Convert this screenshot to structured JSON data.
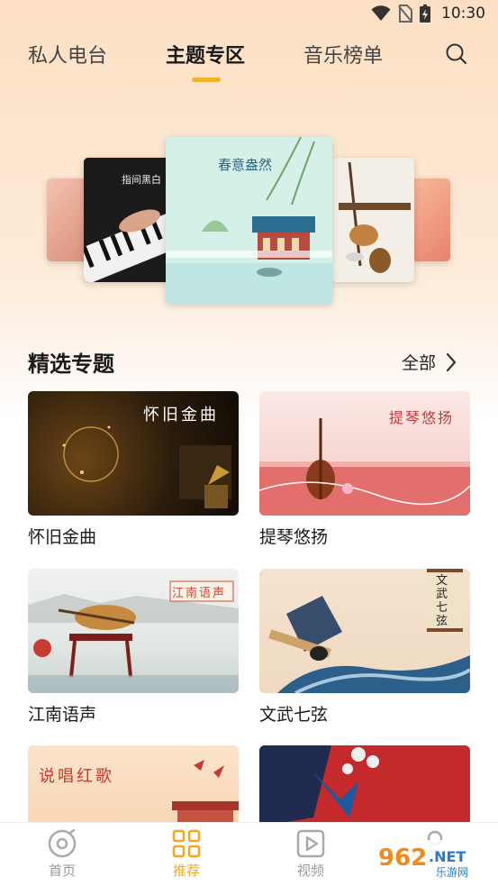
{
  "status_bar": {
    "time": "10:30"
  },
  "top_tabs": [
    {
      "label": "私人电台",
      "active": false
    },
    {
      "label": "主题专区",
      "active": true
    },
    {
      "label": "音乐榜单",
      "active": false
    }
  ],
  "carousel": {
    "center_title": "春意盎然",
    "left_title": "指间黑白"
  },
  "section": {
    "title": "精选专题",
    "all_label": "全部"
  },
  "topics": [
    {
      "caption": "怀旧金曲",
      "overlay": "怀旧金曲"
    },
    {
      "caption": "提琴悠扬",
      "overlay": "提琴悠扬"
    },
    {
      "caption": "江南语声",
      "overlay": "江南语声"
    },
    {
      "caption": "文武七弦",
      "overlay": "文武七弦"
    },
    {
      "caption": "",
      "overlay": "说唱红歌"
    },
    {
      "caption": "",
      "overlay": ""
    }
  ],
  "bottom_nav": [
    {
      "label": "首页",
      "icon": "disc-icon",
      "active": false
    },
    {
      "label": "推荐",
      "icon": "grid-icon",
      "active": true
    },
    {
      "label": "视频",
      "icon": "video-play-icon",
      "active": false
    },
    {
      "label": "",
      "icon": "profile-icon",
      "active": false
    }
  ],
  "watermark": {
    "number": "962",
    "suffix": ".NET",
    "sub": "乐游网"
  },
  "colors": {
    "accent": "#f0b12c",
    "active_nav": "#f0a81c",
    "inactive_nav": "#999999"
  }
}
